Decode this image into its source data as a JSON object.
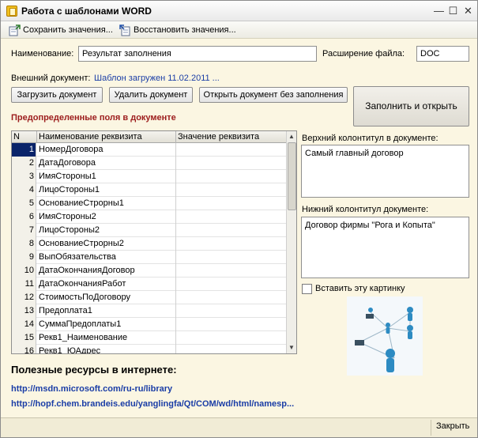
{
  "window": {
    "title": "Работа с шаблонами WORD"
  },
  "toolbar": {
    "save_label": "Сохранить значения...",
    "restore_label": "Восстановить значения..."
  },
  "form": {
    "name_label": "Наименование:",
    "name_value": "Результат заполнения",
    "ext_label": "Расширение файла:",
    "ext_value": "DOC",
    "ext_doc_label": "Внешний документ:",
    "ext_doc_status": "Шаблон загружен 11.02.2011 ..."
  },
  "buttons": {
    "load": "Загрузить документ",
    "delete": "Удалить документ",
    "open_without_fill": "Открыть документ без заполнения",
    "fill_and_open": "Заполнить и открыть"
  },
  "grid": {
    "section_title": "Предопределенные поля в документе",
    "columns": [
      "N",
      "Наименование реквизита",
      "Значение реквизита"
    ],
    "rows": [
      {
        "n": "1",
        "name": "НомерДоговора"
      },
      {
        "n": "2",
        "name": "ДатаДоговора"
      },
      {
        "n": "3",
        "name": "ИмяСтороны1"
      },
      {
        "n": "4",
        "name": "ЛицоСтороны1"
      },
      {
        "n": "5",
        "name": "ОснованиеСтрорны1"
      },
      {
        "n": "6",
        "name": "ИмяСтороны2"
      },
      {
        "n": "7",
        "name": "ЛицоСтороны2"
      },
      {
        "n": "8",
        "name": "ОснованиеСтрорны2"
      },
      {
        "n": "9",
        "name": "ВыпОбязательства"
      },
      {
        "n": "10",
        "name": "ДатаОкончанияДоговор"
      },
      {
        "n": "11",
        "name": "ДатаОкончанияРабот"
      },
      {
        "n": "12",
        "name": "СтоимостьПоДоговору"
      },
      {
        "n": "13",
        "name": "Предоплата1"
      },
      {
        "n": "14",
        "name": "СуммаПредоплаты1"
      },
      {
        "n": "15",
        "name": "Рекв1_Наименование"
      },
      {
        "n": "16",
        "name": "Рекв1_ЮАдрес"
      }
    ]
  },
  "header_footer": {
    "top_label": "Верхний колонтитул в документе:",
    "top_value": "Самый главный договор",
    "bottom_label": "Нижний колонтитул документе:",
    "bottom_value": "Договор фирмы \"Рога и Копыта\"",
    "insert_image_label": "Вставить эту картинку"
  },
  "resources": {
    "heading": "Полезные ресурсы в интернете:",
    "link1": "http://msdn.microsoft.com/ru-ru/library",
    "link2": "http://hopf.chem.brandeis.edu/yanglingfa/Qt/COM/wd/html/namesp..."
  },
  "footer": {
    "close_label": "Закрыть"
  },
  "icons": {
    "save": "save-values-icon",
    "restore": "restore-values-icon",
    "network": "network-people-illustration"
  }
}
